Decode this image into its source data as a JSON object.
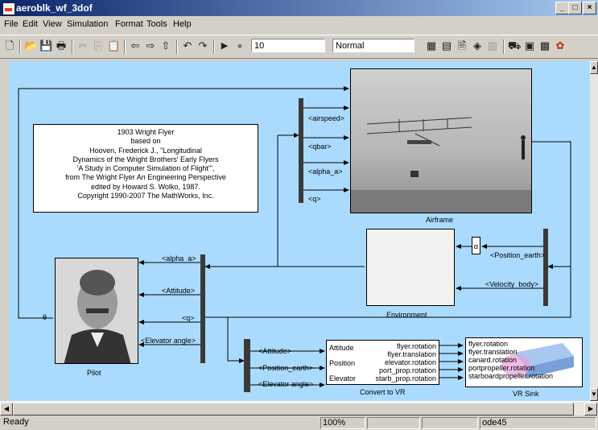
{
  "window": {
    "title": "aeroblk_wf_3dof",
    "minimize": "_",
    "maximize": "□",
    "close": "×"
  },
  "menu": [
    "File",
    "Edit",
    "View",
    "Simulation",
    "Format",
    "Tools",
    "Help"
  ],
  "toolbar": {
    "stop_time": "10",
    "sim_mode": "Normal"
  },
  "note_lines": [
    "1903 Wright Flyer",
    "based on",
    "Hooven, Frederick J., \"Longitudinal",
    "Dynamics of the Wright Brothers' Early Flyers",
    "'A Study in Computer Simulation of Flight'\",",
    "from The Wright Flyer An Engineering Perspective",
    "edited by Howard S. Wolko, 1987.",
    "Copyright 1990-2007 The MathWorks, Inc."
  ],
  "blocks": {
    "airframe": "Airframe",
    "environment": "Environment",
    "pilot": "Pilot",
    "convert": "Convert to VR",
    "vrsink": "VR Sink",
    "delay": "α"
  },
  "signals": {
    "airspeed": "<airspeed>",
    "qbar": "<qbar>",
    "alpha_a_top": "<alpha_a>",
    "q_top": "<q>",
    "alpha_a": "<alpha_a>",
    "attitude": "<Attitude>",
    "q": "<q>",
    "elevator_angle": "<Elevator angle>",
    "position_earth_env": "<Position_earth>",
    "velocity_body": "<Velocity_body>",
    "attitude_vr": "<Attitude>",
    "position_earth_vr": "<Position_earth>",
    "elevator_angle_vr": "<Elevator angle>",
    "theta": "θ"
  },
  "convert_ports": {
    "inputs": [
      "Attitude",
      "Position",
      "Elevator"
    ],
    "outputs": [
      "flyer.rotation",
      "flyer.translation",
      "elevator.rotation",
      "port_prop.rotation",
      "starb_prop.rotation"
    ]
  },
  "vr_ports": [
    "flyer.rotation",
    "flyer.translation",
    "canard.rotation",
    "portpropeller.rotation",
    "starboardpropeller.rotation"
  ],
  "status": {
    "text": "Ready",
    "zoom": "100%",
    "solver": "ode45"
  }
}
